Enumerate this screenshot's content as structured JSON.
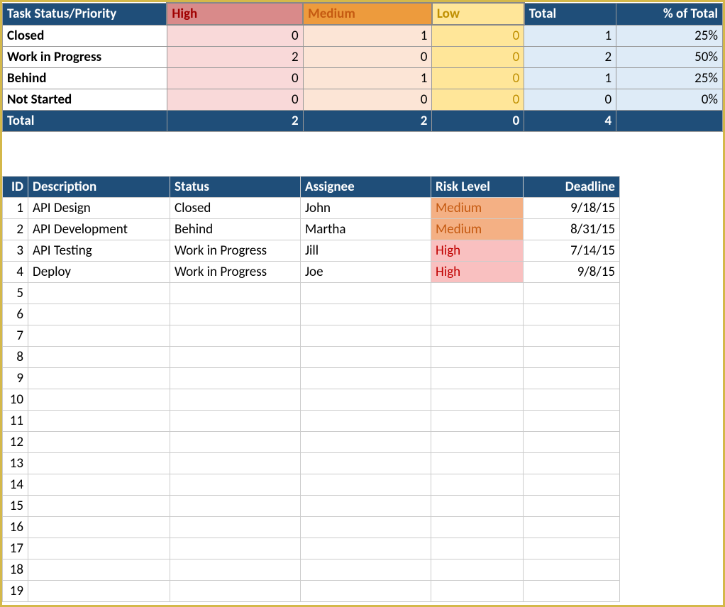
{
  "summary": {
    "title": "Task Status/Priority",
    "cols": {
      "high": "High",
      "medium": "Medium",
      "low": "Low",
      "total": "Total",
      "pct": "% of Total"
    },
    "rows": [
      {
        "label": "Closed",
        "high": "0",
        "med": "1",
        "low": "0",
        "total": "1",
        "pct": "25%"
      },
      {
        "label": "Work in Progress",
        "high": "2",
        "med": "0",
        "low": "0",
        "total": "2",
        "pct": "50%"
      },
      {
        "label": "Behind",
        "high": "0",
        "med": "1",
        "low": "0",
        "total": "1",
        "pct": "25%"
      },
      {
        "label": "Not Started",
        "high": "0",
        "med": "0",
        "low": "0",
        "total": "0",
        "pct": "0%"
      }
    ],
    "total": {
      "label": "Total",
      "high": "2",
      "med": "2",
      "low": "0",
      "total": "4",
      "pct": ""
    }
  },
  "tasks": {
    "headers": {
      "id": "ID",
      "desc": "Description",
      "status": "Status",
      "assignee": "Assignee",
      "risk": "Risk Level",
      "deadline": "Deadline"
    },
    "rows": [
      {
        "id": "1",
        "desc": "API Design",
        "status": "Closed",
        "assignee": "John",
        "risk": "Medium",
        "deadline": "9/18/15"
      },
      {
        "id": "2",
        "desc": "API Development",
        "status": "Behind",
        "assignee": "Martha",
        "risk": "Medium",
        "deadline": "8/31/15"
      },
      {
        "id": "3",
        "desc": "API Testing",
        "status": "Work in Progress",
        "assignee": "Jill",
        "risk": "High",
        "deadline": "7/14/15"
      },
      {
        "id": "4",
        "desc": "Deploy",
        "status": "Work in Progress",
        "assignee": "Joe",
        "risk": "High",
        "deadline": "9/8/15"
      },
      {
        "id": "5",
        "desc": "",
        "status": "",
        "assignee": "",
        "risk": "",
        "deadline": ""
      },
      {
        "id": "6",
        "desc": "",
        "status": "",
        "assignee": "",
        "risk": "",
        "deadline": ""
      },
      {
        "id": "7",
        "desc": "",
        "status": "",
        "assignee": "",
        "risk": "",
        "deadline": ""
      },
      {
        "id": "8",
        "desc": "",
        "status": "",
        "assignee": "",
        "risk": "",
        "deadline": ""
      },
      {
        "id": "9",
        "desc": "",
        "status": "",
        "assignee": "",
        "risk": "",
        "deadline": ""
      },
      {
        "id": "10",
        "desc": "",
        "status": "",
        "assignee": "",
        "risk": "",
        "deadline": ""
      },
      {
        "id": "11",
        "desc": "",
        "status": "",
        "assignee": "",
        "risk": "",
        "deadline": ""
      },
      {
        "id": "12",
        "desc": "",
        "status": "",
        "assignee": "",
        "risk": "",
        "deadline": ""
      },
      {
        "id": "13",
        "desc": "",
        "status": "",
        "assignee": "",
        "risk": "",
        "deadline": ""
      },
      {
        "id": "14",
        "desc": "",
        "status": "",
        "assignee": "",
        "risk": "",
        "deadline": ""
      },
      {
        "id": "15",
        "desc": "",
        "status": "",
        "assignee": "",
        "risk": "",
        "deadline": ""
      },
      {
        "id": "16",
        "desc": "",
        "status": "",
        "assignee": "",
        "risk": "",
        "deadline": ""
      },
      {
        "id": "17",
        "desc": "",
        "status": "",
        "assignee": "",
        "risk": "",
        "deadline": ""
      },
      {
        "id": "18",
        "desc": "",
        "status": "",
        "assignee": "",
        "risk": "",
        "deadline": ""
      },
      {
        "id": "19",
        "desc": "",
        "status": "",
        "assignee": "",
        "risk": "",
        "deadline": ""
      }
    ]
  },
  "chart_data": {
    "type": "table",
    "title": "Task Status/Priority",
    "categories": [
      "Closed",
      "Work in Progress",
      "Behind",
      "Not Started",
      "Total"
    ],
    "series": [
      {
        "name": "High",
        "values": [
          0,
          2,
          0,
          0,
          2
        ]
      },
      {
        "name": "Medium",
        "values": [
          1,
          0,
          1,
          0,
          2
        ]
      },
      {
        "name": "Low",
        "values": [
          0,
          0,
          0,
          0,
          0
        ]
      },
      {
        "name": "Total",
        "values": [
          1,
          2,
          1,
          0,
          4
        ]
      },
      {
        "name": "% of Total",
        "values": [
          25,
          50,
          25,
          0,
          null
        ]
      }
    ]
  }
}
